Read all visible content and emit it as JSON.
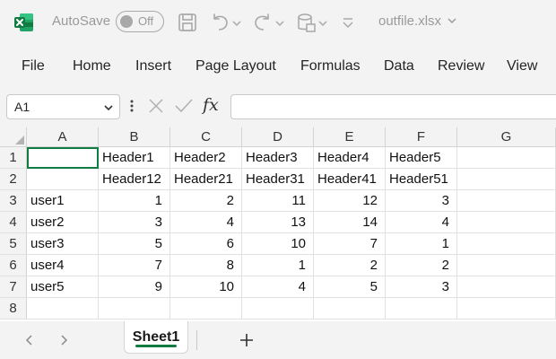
{
  "titlebar": {
    "autosave_label": "AutoSave",
    "autosave_state": "Off",
    "filename": "outfile.xlsx",
    "icons": [
      "excel-logo-icon",
      "save-icon",
      "undo-icon",
      "redo-icon",
      "data-form-icon",
      "customize-qat-icon"
    ]
  },
  "ribbon": {
    "tabs": [
      "File",
      "Home",
      "Insert",
      "Page Layout",
      "Formulas",
      "Data",
      "Review",
      "View"
    ]
  },
  "formula_bar": {
    "name_box": "A1",
    "fx_label": "fx",
    "formula": ""
  },
  "grid": {
    "columns": [
      "A",
      "B",
      "C",
      "D",
      "E",
      "F",
      "G"
    ],
    "rows": [
      "1",
      "2",
      "3",
      "4",
      "5",
      "6",
      "7",
      "8"
    ],
    "cells": [
      [
        "",
        "Header1",
        "Header2",
        "Header3",
        "Header4",
        "Header5",
        ""
      ],
      [
        "",
        "Header12",
        "Header21",
        "Header31",
        "Header41",
        "Header51",
        ""
      ],
      [
        "user1",
        "1",
        "2",
        "11",
        "12",
        "3",
        ""
      ],
      [
        "user2",
        "3",
        "4",
        "13",
        "14",
        "4",
        ""
      ],
      [
        "user3",
        "5",
        "6",
        "10",
        "7",
        "1",
        ""
      ],
      [
        "user4",
        "7",
        "8",
        "1",
        "2",
        "2",
        ""
      ],
      [
        "user5",
        "9",
        "10",
        "4",
        "5",
        "3",
        ""
      ],
      [
        "",
        "",
        "",
        "",
        "",
        "",
        ""
      ]
    ],
    "selected_cell": "A1"
  },
  "sheets": {
    "tabs": [
      "Sheet1"
    ],
    "active": "Sheet1"
  },
  "colors": {
    "accent": "#107c41",
    "excel_green": "#107c41"
  }
}
